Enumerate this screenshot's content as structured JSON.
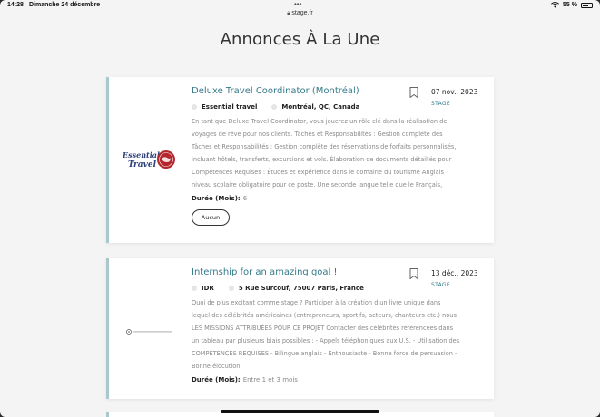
{
  "status_bar": {
    "time": "14:28",
    "date": "Dimanche 24 décembre",
    "battery": "55 %"
  },
  "url_bar": {
    "domain": "stage.fr"
  },
  "page": {
    "title": "Annonces À La Une"
  },
  "listings": [
    {
      "company_logo_text": "Essential Travel",
      "title": "Deluxe Travel Coordinator (Montréal)",
      "company": "Essential travel",
      "location": "Montréal, QC, Canada",
      "date": "07 nov., 2023",
      "type": "STAGE",
      "description_lines": [
        "En tant que Deluxe Travel Coordinator, vous jouerez un rôle clé dans la réalisation de",
        "voyages de rêve pour nos clients. Tâches et Responsabilités : Gestion complète des",
        "Tâches et Responsabilités : Gestion complète des réservations de forfaits personnalisés,",
        "incluant hôtels, transferts, excursions et vols. Élaboration de documents détaillés pour",
        "Compétences Requises : Études et expérience dans le domaine du tourisme  Anglais",
        "niveau scolaire obligatoire pour ce poste. Une seconde langue telle que le Français,"
      ],
      "duration_label": "Durée (Mois):",
      "duration_value": "6",
      "button_label": "Aucun"
    },
    {
      "company_logo_text": "",
      "title": "Internship for an amazing goal !",
      "company": "IDR",
      "location": "5 Rue Surcouf, 75007 Paris, France",
      "date": "13 déc., 2023",
      "type": "STAGE",
      "description_lines": [
        "Quoi de plus excitant comme stage ? Participer à la création d'un livre unique dans",
        "lequel des célébrités américaines (entrepreneurs, sportifs, acteurs, chanteurs etc.) nous",
        "LES MISSIONS ATTRIBUÉES POUR CE PROJET Contacter des célébrités référencées dans",
        "un tableau par plusieurs biais possibles : - Appels téléphoniques aux U.S. - Utilisation des",
        "COMPÉTENCES REQUISES - Bilingue anglais - Enthousiaste - Bonne force de persuasion -",
        "Bonne élocution"
      ],
      "duration_label": "Durée (Mois):",
      "duration_value": "Entre 1 et 3 mois"
    }
  ],
  "colors": {
    "accent": "#357a8a",
    "card_border": "#a9c8cc",
    "logo_red": "#b3262e"
  }
}
